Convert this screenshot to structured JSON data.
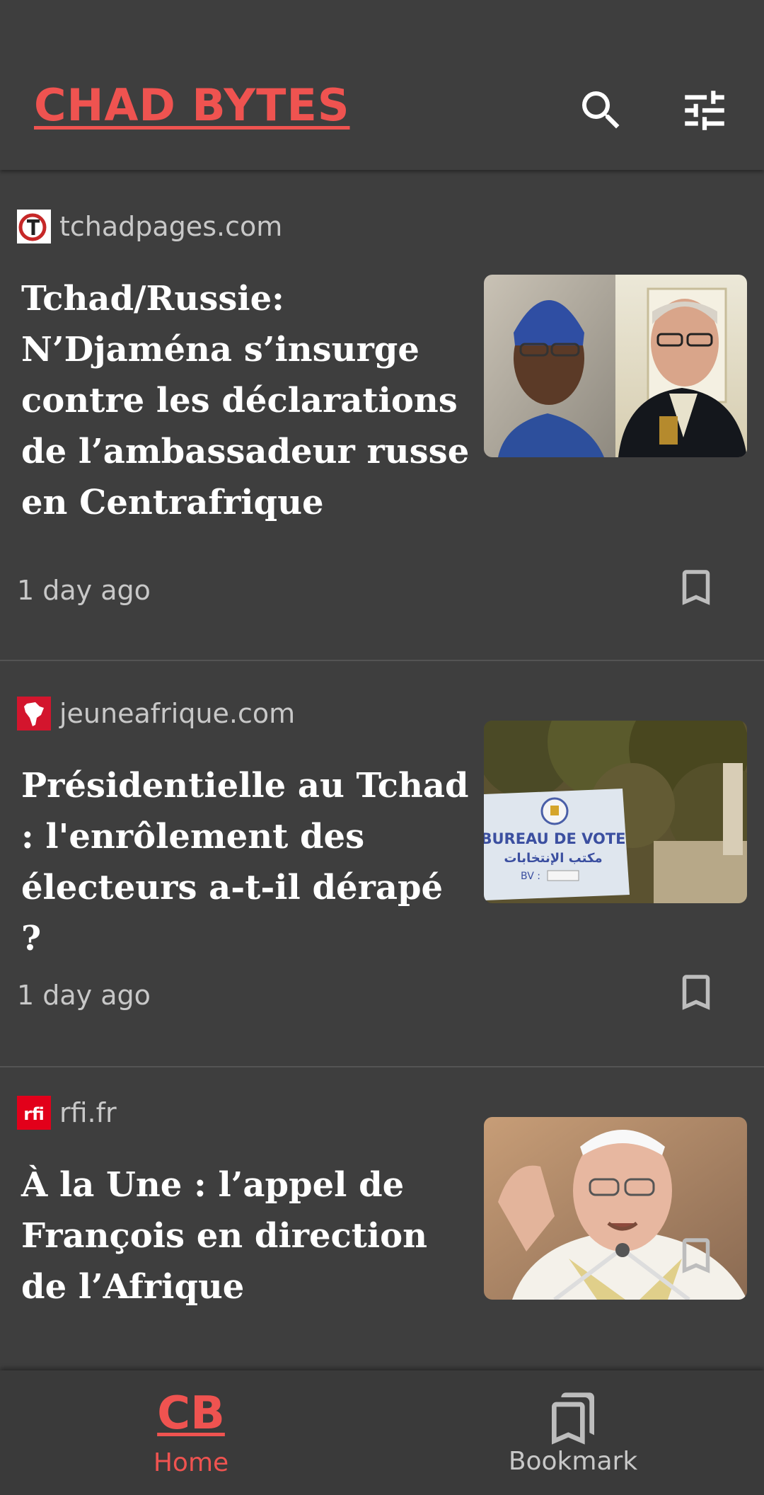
{
  "header": {
    "title": "CHAD BYTES",
    "search_icon": "search-icon",
    "filter_icon": "tune-sliders-icon"
  },
  "colors": {
    "accent": "#ef5350",
    "background": "#3e3e3e",
    "text_primary": "#ffffff",
    "text_secondary": "#c8c8c8"
  },
  "articles": [
    {
      "source": "tchadpages.com",
      "headline": "Tchad/Russie: N’Djaména s’insurge contre les déclarations de l’ambassadeur russe en Centrafrique",
      "time": "1 day ago",
      "bookmark_icon": "bookmark-outline-icon"
    },
    {
      "source": "jeuneafrique.com",
      "headline": "Présidentielle au Tchad : l'enrôlement des électeurs a-t-il dérapé ?",
      "time": "1 day ago",
      "bookmark_icon": "bookmark-outline-icon",
      "thumbnail_text": {
        "line1": "BUREAU DE VOTE",
        "line2": "مكتب الإنتخابات",
        "line3": "BV :"
      }
    },
    {
      "source": "rfi.fr",
      "headline": "À la Une : l’appel de François en direction de l’Afrique",
      "bookmark_icon": "bookmark-outline-icon"
    }
  ],
  "bottom_nav": {
    "home_logo": "CB",
    "home_label": "Home",
    "bookmark_label": "Bookmark",
    "active": "Home"
  }
}
